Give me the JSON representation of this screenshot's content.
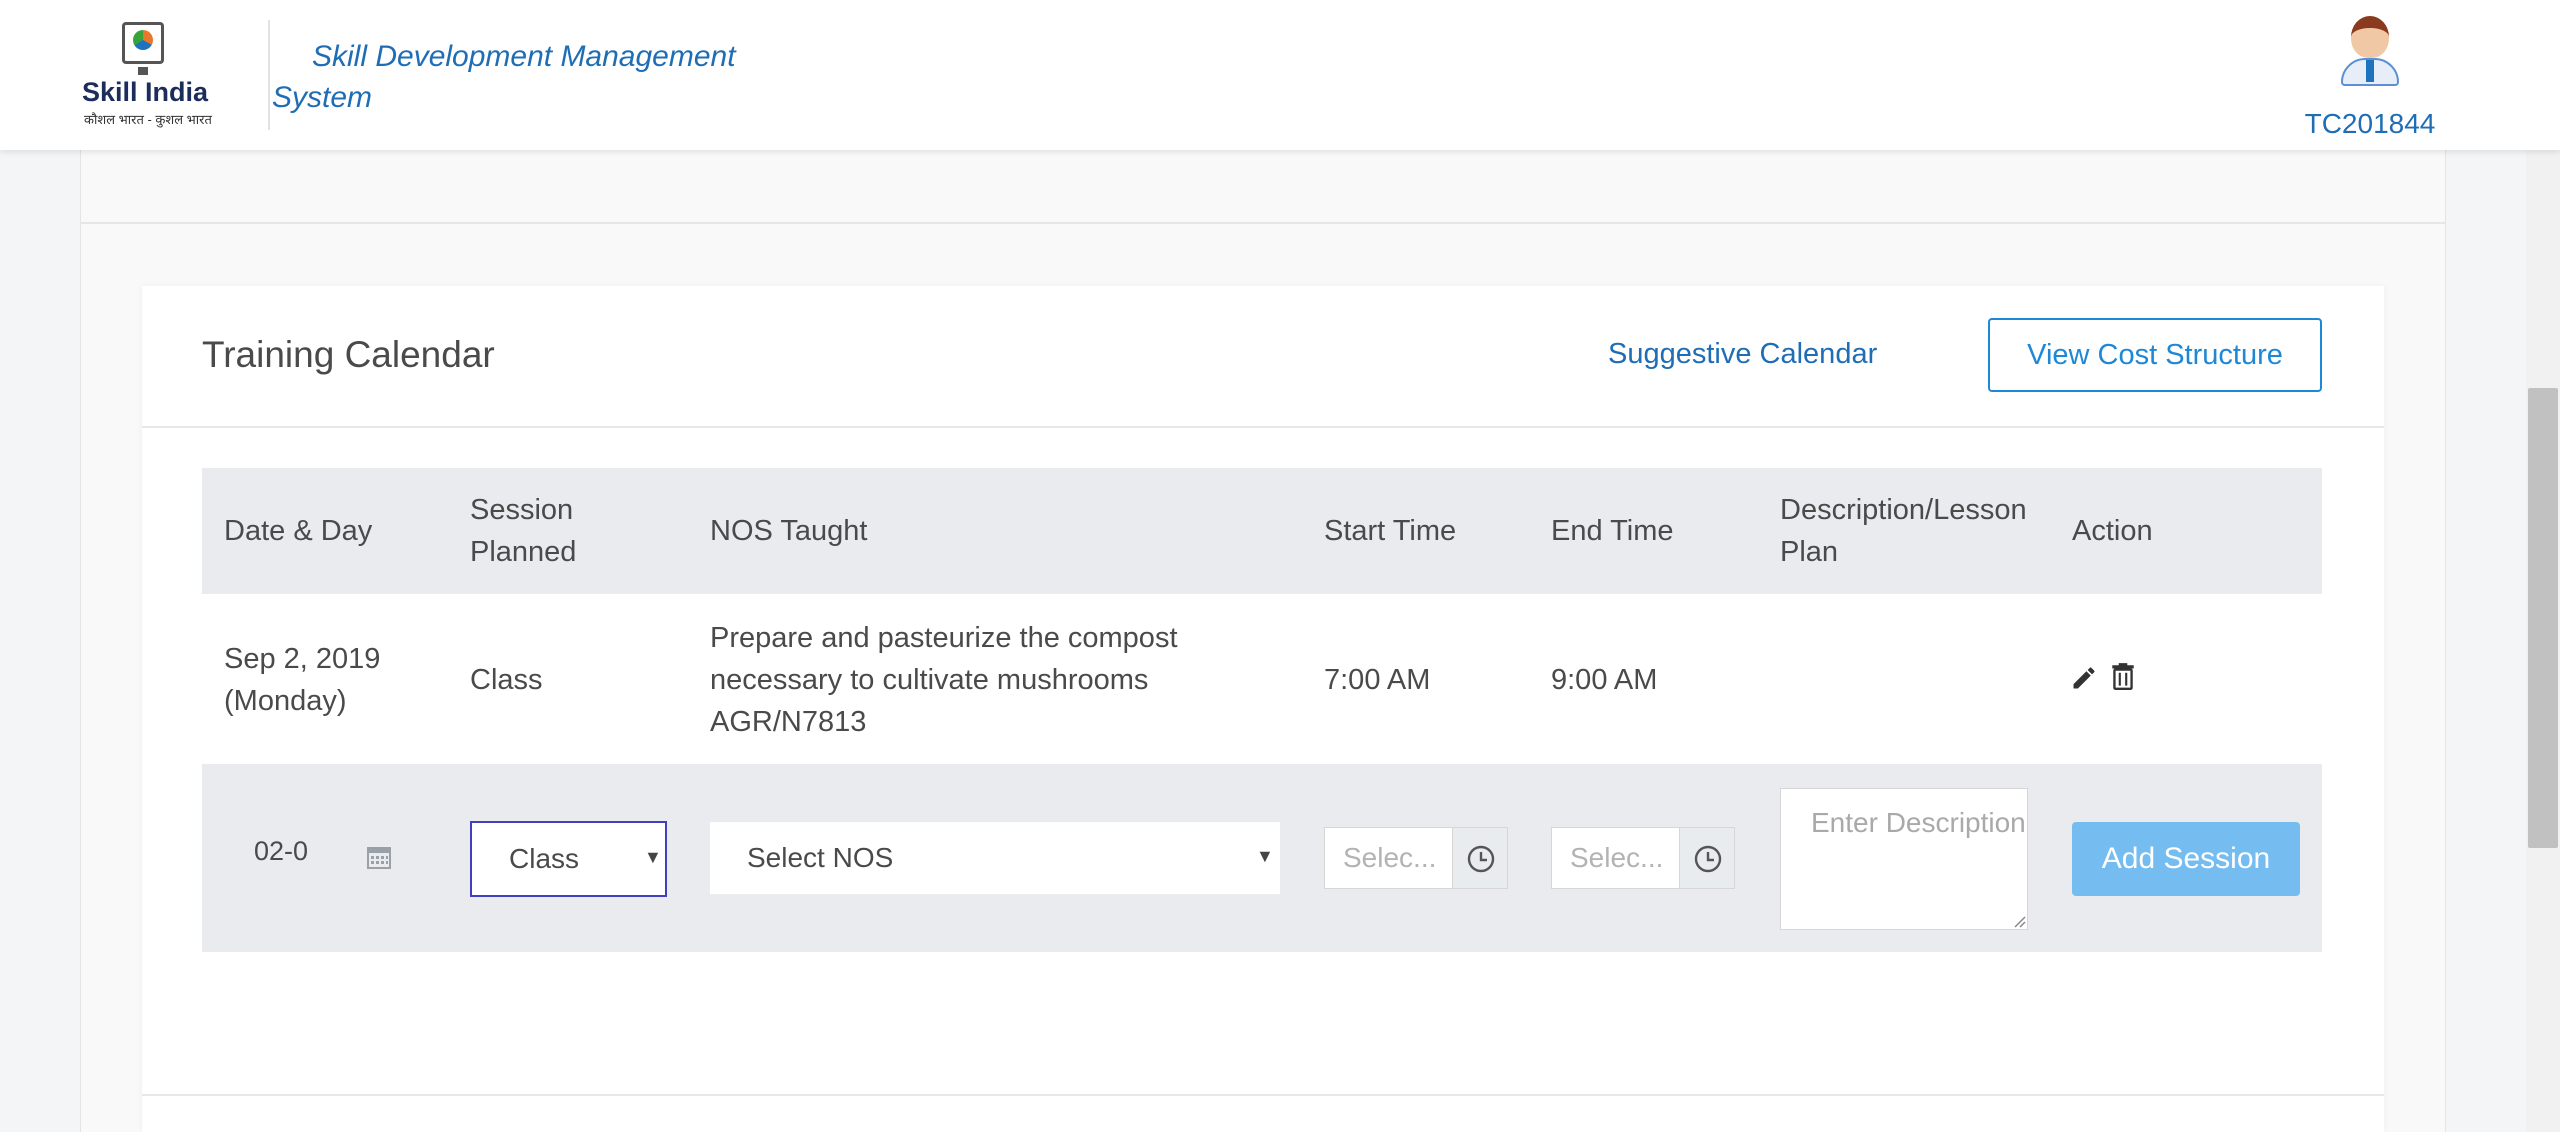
{
  "header": {
    "brand": "Skill India",
    "tagline": "कौशल भारत - कुशल भारत",
    "app_title": "Skill Development Management System",
    "user_id": "TC201844"
  },
  "card": {
    "title": "Training Calendar",
    "suggestive_link": "Suggestive Calendar",
    "cost_button": "View Cost Structure"
  },
  "table": {
    "headers": {
      "date_day": "Date & Day",
      "session_planned": "Session Planned",
      "nos_taught": "NOS Taught",
      "start_time": "Start Time",
      "end_time": "End Time",
      "description": "Description/Lesson Plan",
      "action": "Action"
    },
    "rows": [
      {
        "date": "Sep 2, 2019",
        "day": "(Monday)",
        "session": "Class",
        "nos": "Prepare and pasteurize the compost necessary to cultivate mushrooms AGR/N7813",
        "start": "7:00 AM",
        "end": "9:00 AM",
        "description": ""
      }
    ]
  },
  "form": {
    "date_value": "02-0",
    "session_value": "Class",
    "nos_placeholder": "Select NOS",
    "start_placeholder": "Selec...",
    "end_placeholder": "Selec...",
    "description_placeholder": "Enter Description",
    "add_button": "Add Session"
  },
  "colors": {
    "accent": "#1e6db5",
    "button_border": "#1e88d6",
    "add_button": "#75bdf0",
    "table_header_bg": "#e9ebef"
  }
}
